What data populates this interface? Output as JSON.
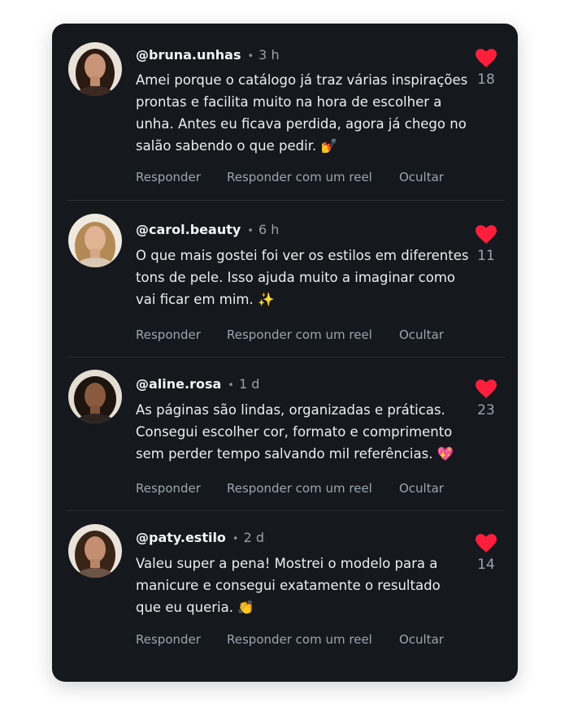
{
  "colors": {
    "card_background": "#15181c",
    "heart": "#ff1f3d",
    "muted_text": "#9aa6b2"
  },
  "comments": [
    {
      "username": "@bruna.unhas",
      "separator": "•",
      "time": "3 h",
      "text": "Amei porque o catálogo já traz várias inspirações prontas e facilita muito na hora de escolher a unha. Antes eu ficava perdida, agora já chego no salão sabendo o que pedir. 💅",
      "likes": "18",
      "actions": {
        "reply": "Responder",
        "reply_reel": "Responder com um reel",
        "hide": "Ocultar"
      }
    },
    {
      "username": "@carol.beauty",
      "separator": "•",
      "time": "6 h",
      "text": "O que mais gostei foi ver os estilos em diferentes tons de pele. Isso ajuda muito a imaginar como vai ficar em mim. ✨",
      "likes": "11",
      "actions": {
        "reply": "Responder",
        "reply_reel": "Responder com um reel",
        "hide": "Ocultar"
      }
    },
    {
      "username": "@aline.rosa",
      "separator": "•",
      "time": "1 d",
      "text": "As páginas são lindas, organizadas e práticas. Consegui escolher cor, formato e comprimento sem perder tempo salvando mil referências. 💖",
      "likes": "23",
      "actions": {
        "reply": "Responder",
        "reply_reel": "Responder com um reel",
        "hide": "Ocultar"
      }
    },
    {
      "username": "@paty.estilo",
      "separator": "•",
      "time": "2 d",
      "text": "Valeu super a pena! Mostrei o modelo para a manicure e consegui exatamente o resultado que eu queria. 👏",
      "likes": "14",
      "actions": {
        "reply": "Responder",
        "reply_reel": "Responder com um reel",
        "hide": "Ocultar"
      }
    }
  ]
}
